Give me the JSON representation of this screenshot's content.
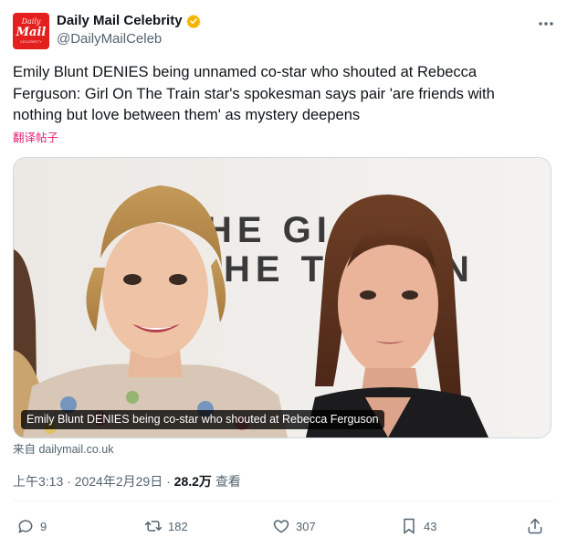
{
  "header": {
    "avatar": {
      "line1": "Daily",
      "line2": "Mail",
      "line3": "CELEBRITY"
    },
    "display_name": "Daily Mail Celebrity",
    "handle": "@DailyMailCeleb",
    "verified_color": "#f4b400",
    "more_icon": "more-horizontal-icon"
  },
  "tweet": {
    "text": "Emily Blunt DENIES being unnamed co-star who shouted at Rebecca Ferguson: Girl On The Train star's spokesman says pair 'are friends with nothing but love between them' as mystery deepens",
    "translate_link": "翻译帖子",
    "translate_color": "#e4207a"
  },
  "card": {
    "backdrop_text": "HE GI  HE T   N",
    "caption": "Emily Blunt DENIES being co-star who shouted at Rebecca Ferguson",
    "source": "来自 dailymail.co.uk"
  },
  "meta": {
    "time": "上午3:13",
    "separator": "·",
    "date": "2024年2月29日",
    "views_count": "28.2万",
    "views_label": "查看"
  },
  "actions": {
    "reply": {
      "icon": "reply-icon",
      "count": "9"
    },
    "retweet": {
      "icon": "retweet-icon",
      "count": "182"
    },
    "like": {
      "icon": "heart-icon",
      "count": "307"
    },
    "bookmark": {
      "icon": "bookmark-icon",
      "count": "43"
    },
    "share": {
      "icon": "share-icon"
    }
  },
  "colors": {
    "text": "#0f1419",
    "secondary": "#536471",
    "brand_red": "#e4201f",
    "border": "#cfd9de"
  }
}
